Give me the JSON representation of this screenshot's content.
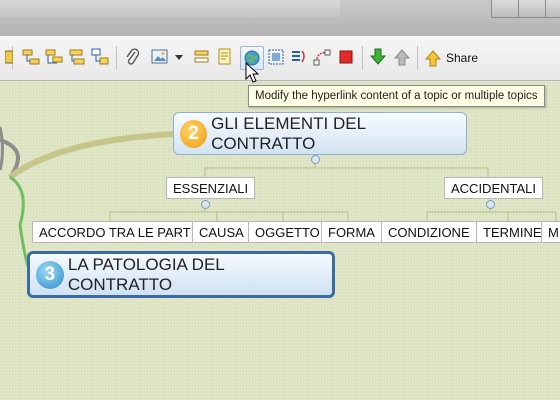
{
  "toolbar": {
    "share_label": "Share",
    "icons": [
      "outline-icon",
      "subtopic-icon",
      "topic-icon",
      "floating-topic-icon",
      "attachment-icon",
      "image-icon",
      "image-dropdown-icon",
      "label-icon",
      "note-icon",
      "hyperlink-icon",
      "boundary-icon",
      "summary-icon",
      "relationship-icon",
      "marker-icon",
      "download-icon",
      "upload-icon",
      "share-icon"
    ]
  },
  "tooltip": {
    "text": "Modify the hyperlink content of a topic or multiple topics"
  },
  "map": {
    "main_topic": {
      "number": "2",
      "label": "GLI ELEMENTI DEL CONTRATTO"
    },
    "branches": [
      {
        "label": "ESSENZIALI",
        "children": [
          "ACCORDO TRA LE PARTI",
          "CAUSA",
          "OGGETTO",
          "FORMA"
        ]
      },
      {
        "label": "ACCIDENTALI",
        "children": [
          "CONDIZIONE",
          "TERMINE",
          "M"
        ]
      }
    ],
    "selected_topic": {
      "number": "3",
      "label": "LA PATOLOGIA DEL CONTRATTO"
    }
  },
  "colors": {
    "main_topic_border": "#8fb0cd",
    "selected_border": "#3c6ba3",
    "canvas": "#dfe5c4",
    "connector": "#c5c78a"
  }
}
